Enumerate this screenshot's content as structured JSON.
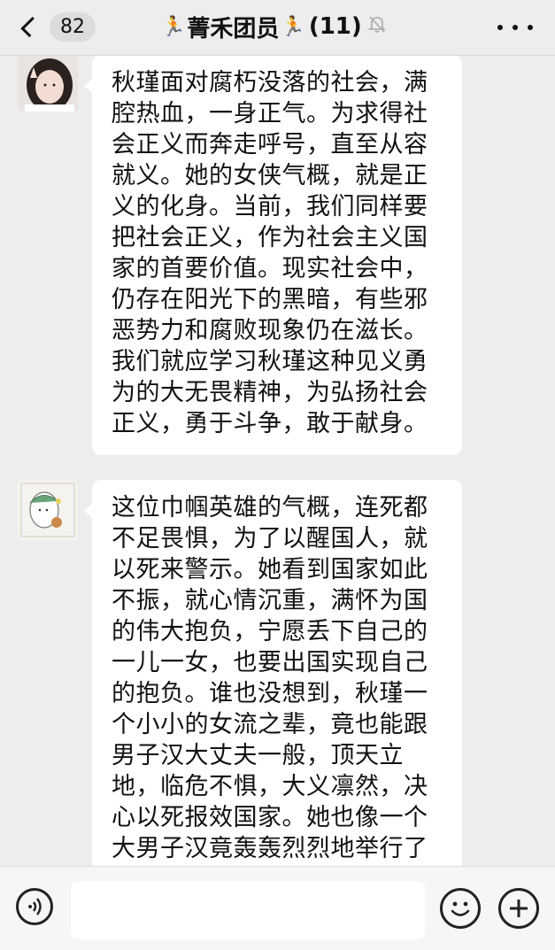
{
  "header": {
    "back_count": "82",
    "title_emoji": "🏃",
    "group_name": "菁禾团员",
    "member_count": "(11)",
    "muted": true
  },
  "messages": [
    {
      "sender": "avatar-1",
      "text": "秋瑾面对腐朽没落的社会，满腔热血，一身正气。为求得社会正义而奔走呼号，直至从容就义。她的女侠气概，就是正义的化身。当前，我们同样要把社会正义，作为社会主义国家的首要价值。现实社会中，仍存在阳光下的黑暗，有些邪恶势力和腐败现象仍在滋长。我们就应学习秋瑾这种见义勇为的大无畏精神，为弘扬社会正义，勇于斗争，敢于献身。"
    },
    {
      "sender": "avatar-2",
      "text": "这位巾帼英雄的气概，连死都不足畏惧，为了以醒国人，就以死来警示。她看到国家如此不振，就心情沉重，满怀为国的伟大抱负，宁愿丢下自己的一儿一女，也要出国实现自己的抱负。谁也没想到，秋瑾一个小小的女流之辈，竟也能跟男子汉大丈夫一般，顶天立地，临危不惧，大义凛然，决心以死报效国家。她也像一个大男子汉竟轰轰烈烈地举行了"
    }
  ],
  "input": {
    "placeholder": ""
  },
  "icons": {
    "back": "chevron-left-icon",
    "mute": "bell-slash-icon",
    "more": "more-dots-icon",
    "voice": "voice-icon",
    "emoji": "emoji-icon",
    "plus": "plus-icon"
  }
}
